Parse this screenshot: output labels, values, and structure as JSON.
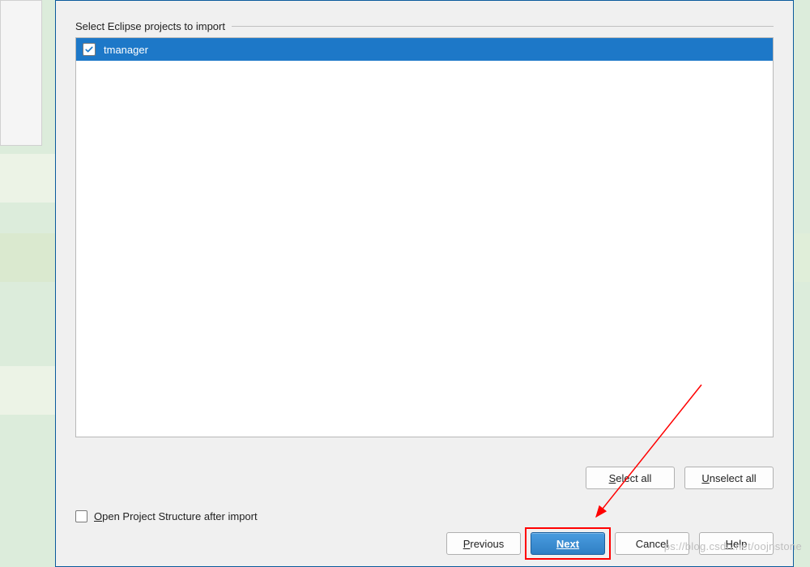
{
  "group_label": "Select Eclipse projects to import",
  "projects": [
    {
      "name": "tmanager",
      "checked": true,
      "selected": true
    }
  ],
  "buttons": {
    "select_all": "Select all",
    "unselect_all": "Unselect all",
    "previous": "Previous",
    "next": "Next",
    "cancel": "Cancel",
    "help": "Help"
  },
  "open_project_structure": {
    "checked": false,
    "label": "Open Project Structure after import"
  },
  "watermark": "ps://blog.csdn.net/oojnstone"
}
